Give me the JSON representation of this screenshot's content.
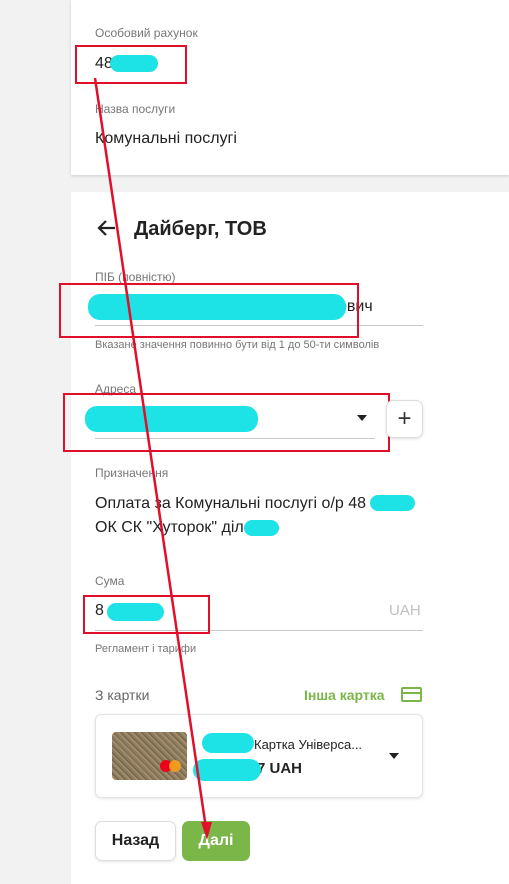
{
  "top_card": {
    "account_label": "Особовий рахунок",
    "account_value": "48",
    "service_label": "Назва послуги",
    "service_value": "Комунальні послугі"
  },
  "header": {
    "back_icon": "arrow-left-icon",
    "title": "Дайберг, ТОВ"
  },
  "form": {
    "name_label": "ПІБ (повністю)",
    "name_value_suffix": "ович",
    "name_hint": "Вказане значення повинно бути від 1 до 50-ти символів",
    "address_label": "Адреса",
    "purpose_label": "Призначення",
    "purpose_line1": "Оплата за Комунальні послугі о/р 48",
    "purpose_line2": "ОК СК \"Хуторок\" діл",
    "amount_label": "Сума",
    "amount_value": "8",
    "amount_currency": "UAH",
    "rules_link": "Регламент і тарифи",
    "from_card_label": "З картки",
    "other_card_link": "Інша картка",
    "card_name": "Картка Універса...",
    "card_currency": "7 UAH"
  },
  "buttons": {
    "back": "Назад",
    "next": "Далі"
  },
  "colors": {
    "accent_green": "#7ab648",
    "annotation_red": "#e0102a",
    "redaction": "#1ee3e6"
  }
}
